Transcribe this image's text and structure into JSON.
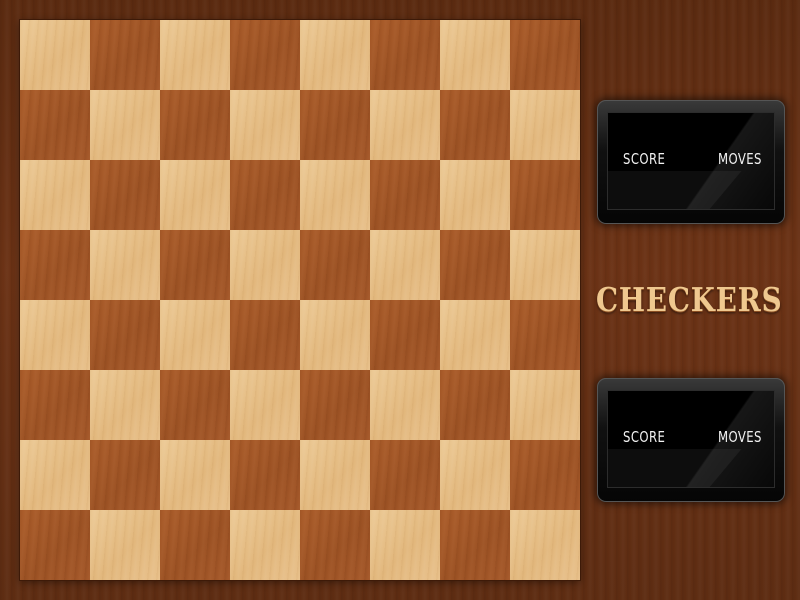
{
  "game": {
    "title": "CHECKERS",
    "board_size": 8,
    "board_colors": {
      "light": "#e6bd86",
      "dark": "#a2572a",
      "frame": "#5d2c12"
    }
  },
  "panels": [
    {
      "id": "top",
      "score_label": "SCORE",
      "moves_label": "MOVES"
    },
    {
      "id": "bottom",
      "score_label": "SCORE",
      "moves_label": "MOVES"
    }
  ]
}
